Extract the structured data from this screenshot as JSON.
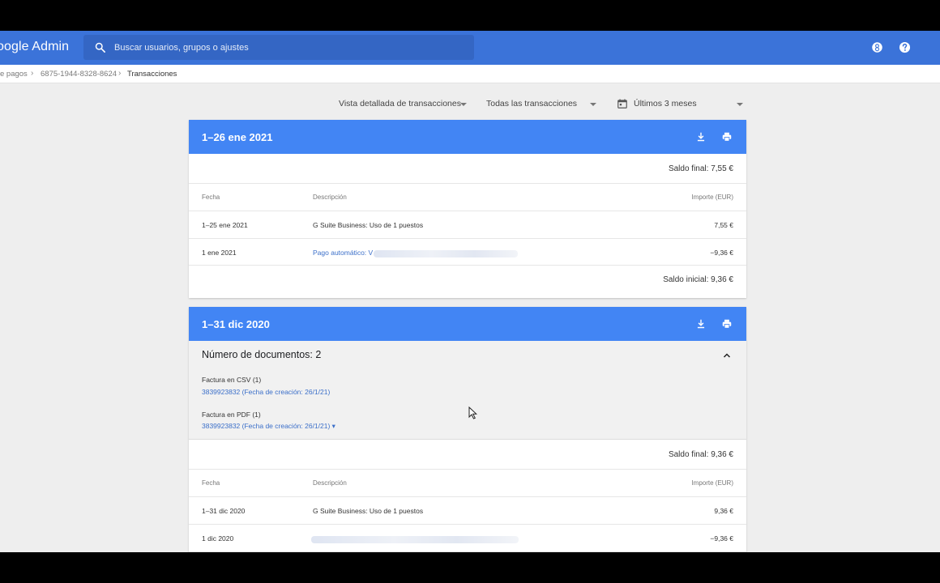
{
  "header": {
    "brand": "oogle Admin",
    "search_placeholder": "Buscar usuarios, grupos o ajustes",
    "icons": [
      "apps-badge-icon",
      "help-icon"
    ]
  },
  "breadcrumb": [
    "e pagos",
    "6875-1944-8328-8624",
    "Transacciones"
  ],
  "filters": {
    "view": "Vista detallada de transacciones",
    "type": "Todas las transacciones",
    "range": "Últimos 3 meses"
  },
  "statements": [
    {
      "title": "1–26 ene 2021",
      "ending_balance": "Saldo final: 7,55 €",
      "columns": [
        "Fecha",
        "Descripción",
        "Importe (EUR)"
      ],
      "rows": [
        {
          "date": "1–25 ene 2021",
          "desc": "G Suite Business: Uso de 1 puestos",
          "amount": "7,55 €"
        },
        {
          "date": "1 ene 2021",
          "desc": "Pago automático: V",
          "amount": "−9,36 €"
        }
      ],
      "starting_balance": "Saldo inicial: 9,36 €"
    },
    {
      "title": "1–31 dic 2020",
      "documents": {
        "count_label": "Número de documentos: 2",
        "items": [
          {
            "label": "Factura en CSV (1)",
            "link": "3839923832 (Fecha de creación: 26/1/21)"
          },
          {
            "label": "Factura en PDF (1)",
            "link": "3839923832 (Fecha de creación: 26/1/21) ▾"
          }
        ]
      },
      "ending_balance": "Saldo final: 9,36 €",
      "columns": [
        "Fecha",
        "Descripción",
        "Importe (EUR)"
      ],
      "rows": [
        {
          "date": "1–31 dic 2020",
          "desc": "G Suite Business: Uso de 1 puestos",
          "amount": "9,36 €"
        },
        {
          "date": "1 dic 2020",
          "desc": "",
          "amount": "−9,36 €"
        }
      ]
    }
  ],
  "colors": {
    "topbar": "#3b73d9",
    "card_header": "#4285f4",
    "link": "#3b6fc9",
    "page_bg": "#eeeeee"
  }
}
